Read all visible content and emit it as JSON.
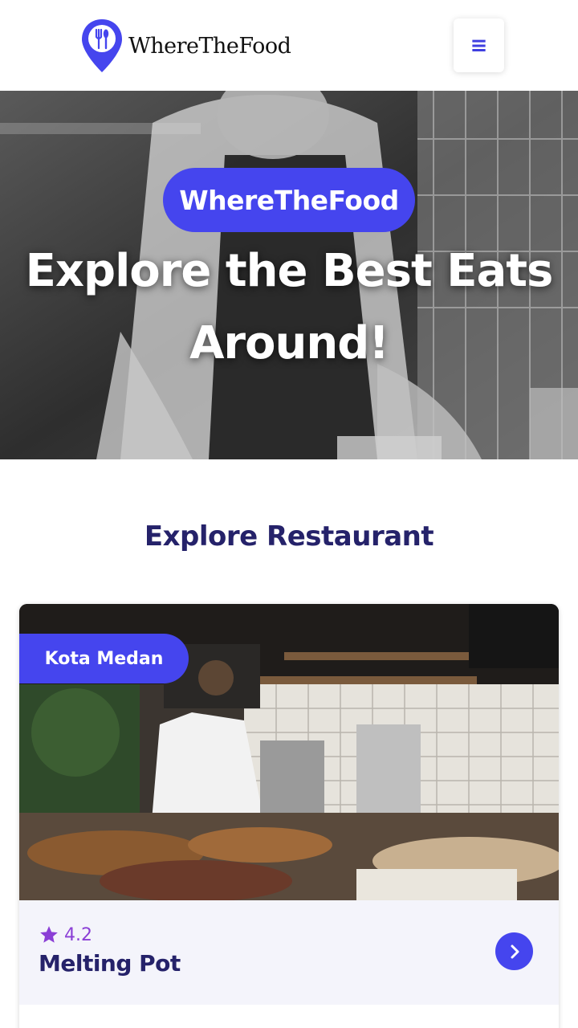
{
  "header": {
    "brand_name": "WhereTheFood",
    "brand_icon": "location-pin-fork-spoon-icon",
    "menu_icon": "hamburger-menu-icon",
    "menu_glyph": "≡"
  },
  "hero": {
    "badge": "WhereTheFood",
    "title": "Explore the Best Eats Around!"
  },
  "section": {
    "title": "Explore Restaurant"
  },
  "restaurants": [
    {
      "city": "Kota Medan",
      "rating": "4.2",
      "name": "Melting Pot"
    }
  ],
  "colors": {
    "primary": "#4545ee",
    "heading": "#25226a",
    "rating": "#8b3fd6",
    "card_body": "#f4f4fb"
  }
}
